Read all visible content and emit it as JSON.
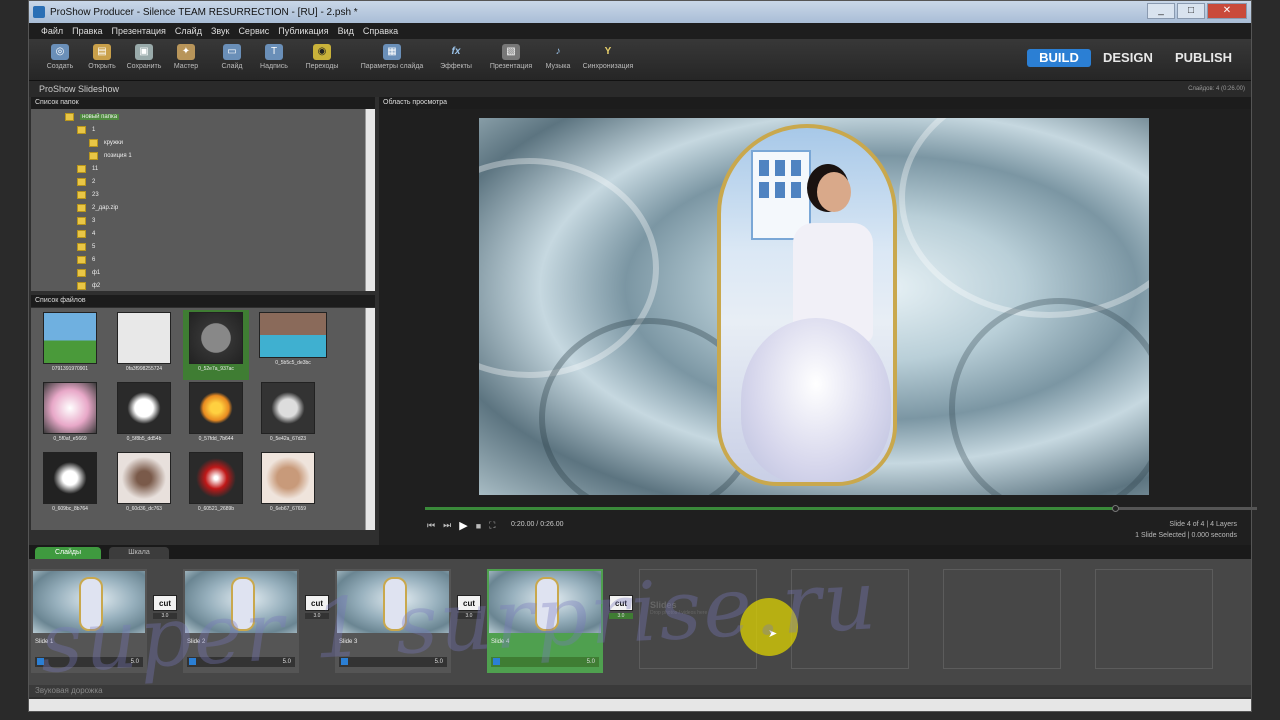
{
  "window": {
    "title": "ProShow Producer - Silence TEAM RESURRECTION - [RU] - 2.psh *",
    "buttons": [
      "_",
      "□",
      "✕"
    ]
  },
  "menu": [
    "Файл",
    "Правка",
    "Презентация",
    "Слайд",
    "Звук",
    "Сервис",
    "Публикация",
    "Вид",
    "Справка"
  ],
  "toolbar": {
    "buttons": [
      {
        "label": "Создать",
        "icon": "new-icon",
        "glyph": "◎"
      },
      {
        "label": "Открыть",
        "icon": "open-folder-icon",
        "glyph": "▤"
      },
      {
        "label": "Сохранить",
        "icon": "save-icon",
        "glyph": "▣"
      },
      {
        "label": "Мастер",
        "icon": "wizard-icon",
        "glyph": "✦"
      },
      {
        "label": "Слайд",
        "icon": "slide-icon",
        "glyph": "▭"
      },
      {
        "label": "Надпись",
        "icon": "caption-icon",
        "glyph": "T"
      },
      {
        "label": "Переходы",
        "icon": "transitions-icon",
        "glyph": "◉"
      },
      {
        "label": "Параметры слайда",
        "icon": "slide-options-icon",
        "glyph": "▦"
      },
      {
        "label": "Эффекты",
        "icon": "effects-icon",
        "glyph": "fx"
      },
      {
        "label": "Презентация",
        "icon": "show-icon",
        "glyph": "▧"
      },
      {
        "label": "Музыка",
        "icon": "music-icon",
        "glyph": "♪"
      },
      {
        "label": "Синхронизация",
        "icon": "sync-icon",
        "glyph": "Y"
      }
    ],
    "modes": {
      "build": "BUILD",
      "design": "DESIGN",
      "publish": "PUBLISH"
    }
  },
  "project": {
    "name": "ProShow Slideshow",
    "meta": "Слайдов: 4 (0:26.00)"
  },
  "folders": {
    "header": "Список папок",
    "items": [
      {
        "label": "новый папка",
        "selected": true
      },
      {
        "label": "1"
      },
      {
        "label": "кружки"
      },
      {
        "label": "позиция 1"
      },
      {
        "label": "11"
      },
      {
        "label": "2"
      },
      {
        "label": "23"
      },
      {
        "label": "2_дар.zip"
      },
      {
        "label": "3"
      },
      {
        "label": "4"
      },
      {
        "label": "5"
      },
      {
        "label": "6"
      },
      {
        "label": "ф1"
      },
      {
        "label": "ф2"
      }
    ]
  },
  "files": {
    "header": "Список файлов",
    "items": [
      {
        "label": "0791391970901",
        "color": "#6fb0e0"
      },
      {
        "label": "0fa3f998255724",
        "color": "#d8d8d8"
      },
      {
        "label": "0_52e7a_937ac",
        "color": "#777777",
        "selected": true
      },
      {
        "label": "0_5b5c5_de3bc",
        "color": "#4a7ea8"
      },
      {
        "label": "0_5f0af_e5669",
        "color": "#e8a8c8"
      },
      {
        "label": "0_5f8b5_dd54b",
        "color": "#2a2a2a"
      },
      {
        "label": "0_57fdd_7b644",
        "color": "#e88a20"
      },
      {
        "label": "0_5e42a_67d23",
        "color": "#333333"
      },
      {
        "label": "0_609bc_8b764",
        "color": "#222222"
      },
      {
        "label": "0_60d36_dc763",
        "color": "#c8b8b0"
      },
      {
        "label": "0_60521_2689b",
        "color": "#c01818"
      },
      {
        "label": "0_6eb67_67659",
        "color": "#d8c0b0"
      }
    ]
  },
  "preview": {
    "header": "Область просмотра",
    "time": "0:20.00 / 0:26.00",
    "progress": 0.83,
    "slide_info": "Slide 4 of 4  |  4 Layers",
    "slide_sub": "1 Slide Selected  |  0.000 seconds"
  },
  "tabs": {
    "slides": "Слайды",
    "timeline": "Шкала"
  },
  "slides": [
    {
      "label": "Slide 1",
      "duration": "5.0",
      "trans": "cut",
      "trans_dur": "3.0",
      "selected": false
    },
    {
      "label": "Slide 2",
      "duration": "5.0",
      "trans": "cut",
      "trans_dur": "3.0",
      "selected": false
    },
    {
      "label": "Slide 3",
      "duration": "5.0",
      "trans": "cut",
      "trans_dur": "3.0",
      "selected": false
    },
    {
      "label": "Slide 4",
      "duration": "5.0",
      "trans": "cut",
      "trans_dur": "3.0",
      "selected": true
    }
  ],
  "empty_slot": {
    "title": "Slides",
    "hint": "Drop photos / videos here"
  },
  "audio_track": "Звуковая дорожка",
  "watermark": "super 1 surprise.ru",
  "colors": {
    "accent": "#2b7fd4",
    "selected_green": "#4fa04f",
    "cursor_highlight": "#dcd200"
  }
}
